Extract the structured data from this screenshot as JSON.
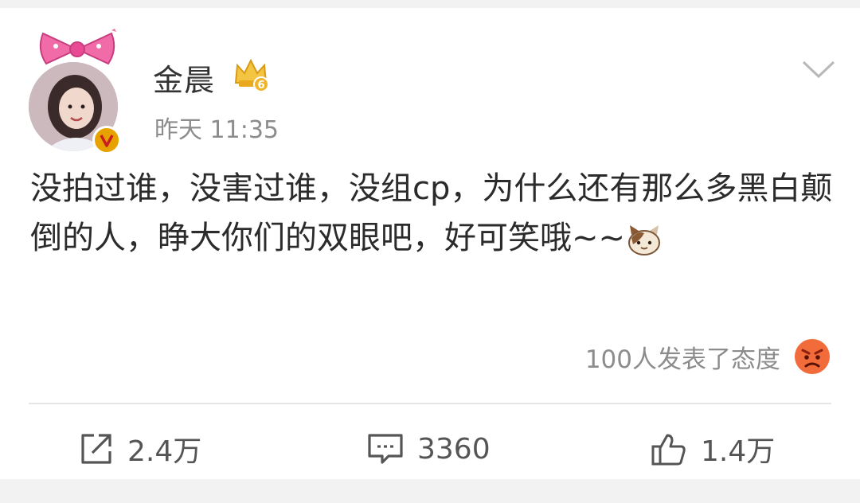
{
  "post": {
    "author": "金晨",
    "level_badge": "6",
    "timestamp": "昨天 11:35",
    "text": "没拍过谁，没害过谁，没组cp，为什么还有那么多黑白颠倒的人，睁大你们的双眼吧，好可笑哦~~",
    "reactions_text": "100人发表了态度"
  },
  "actions": {
    "repost_count": "2.4万",
    "comment_count": "3360",
    "like_count": "1.4万"
  },
  "colors": {
    "verified": "#e8a200",
    "crown": "#f0b429",
    "angry_emoji": "#f26b3a"
  },
  "icons": {
    "repost": "share-icon",
    "comment": "comment-icon",
    "like": "thumbs-up-icon",
    "menu": "chevron-down-icon"
  }
}
